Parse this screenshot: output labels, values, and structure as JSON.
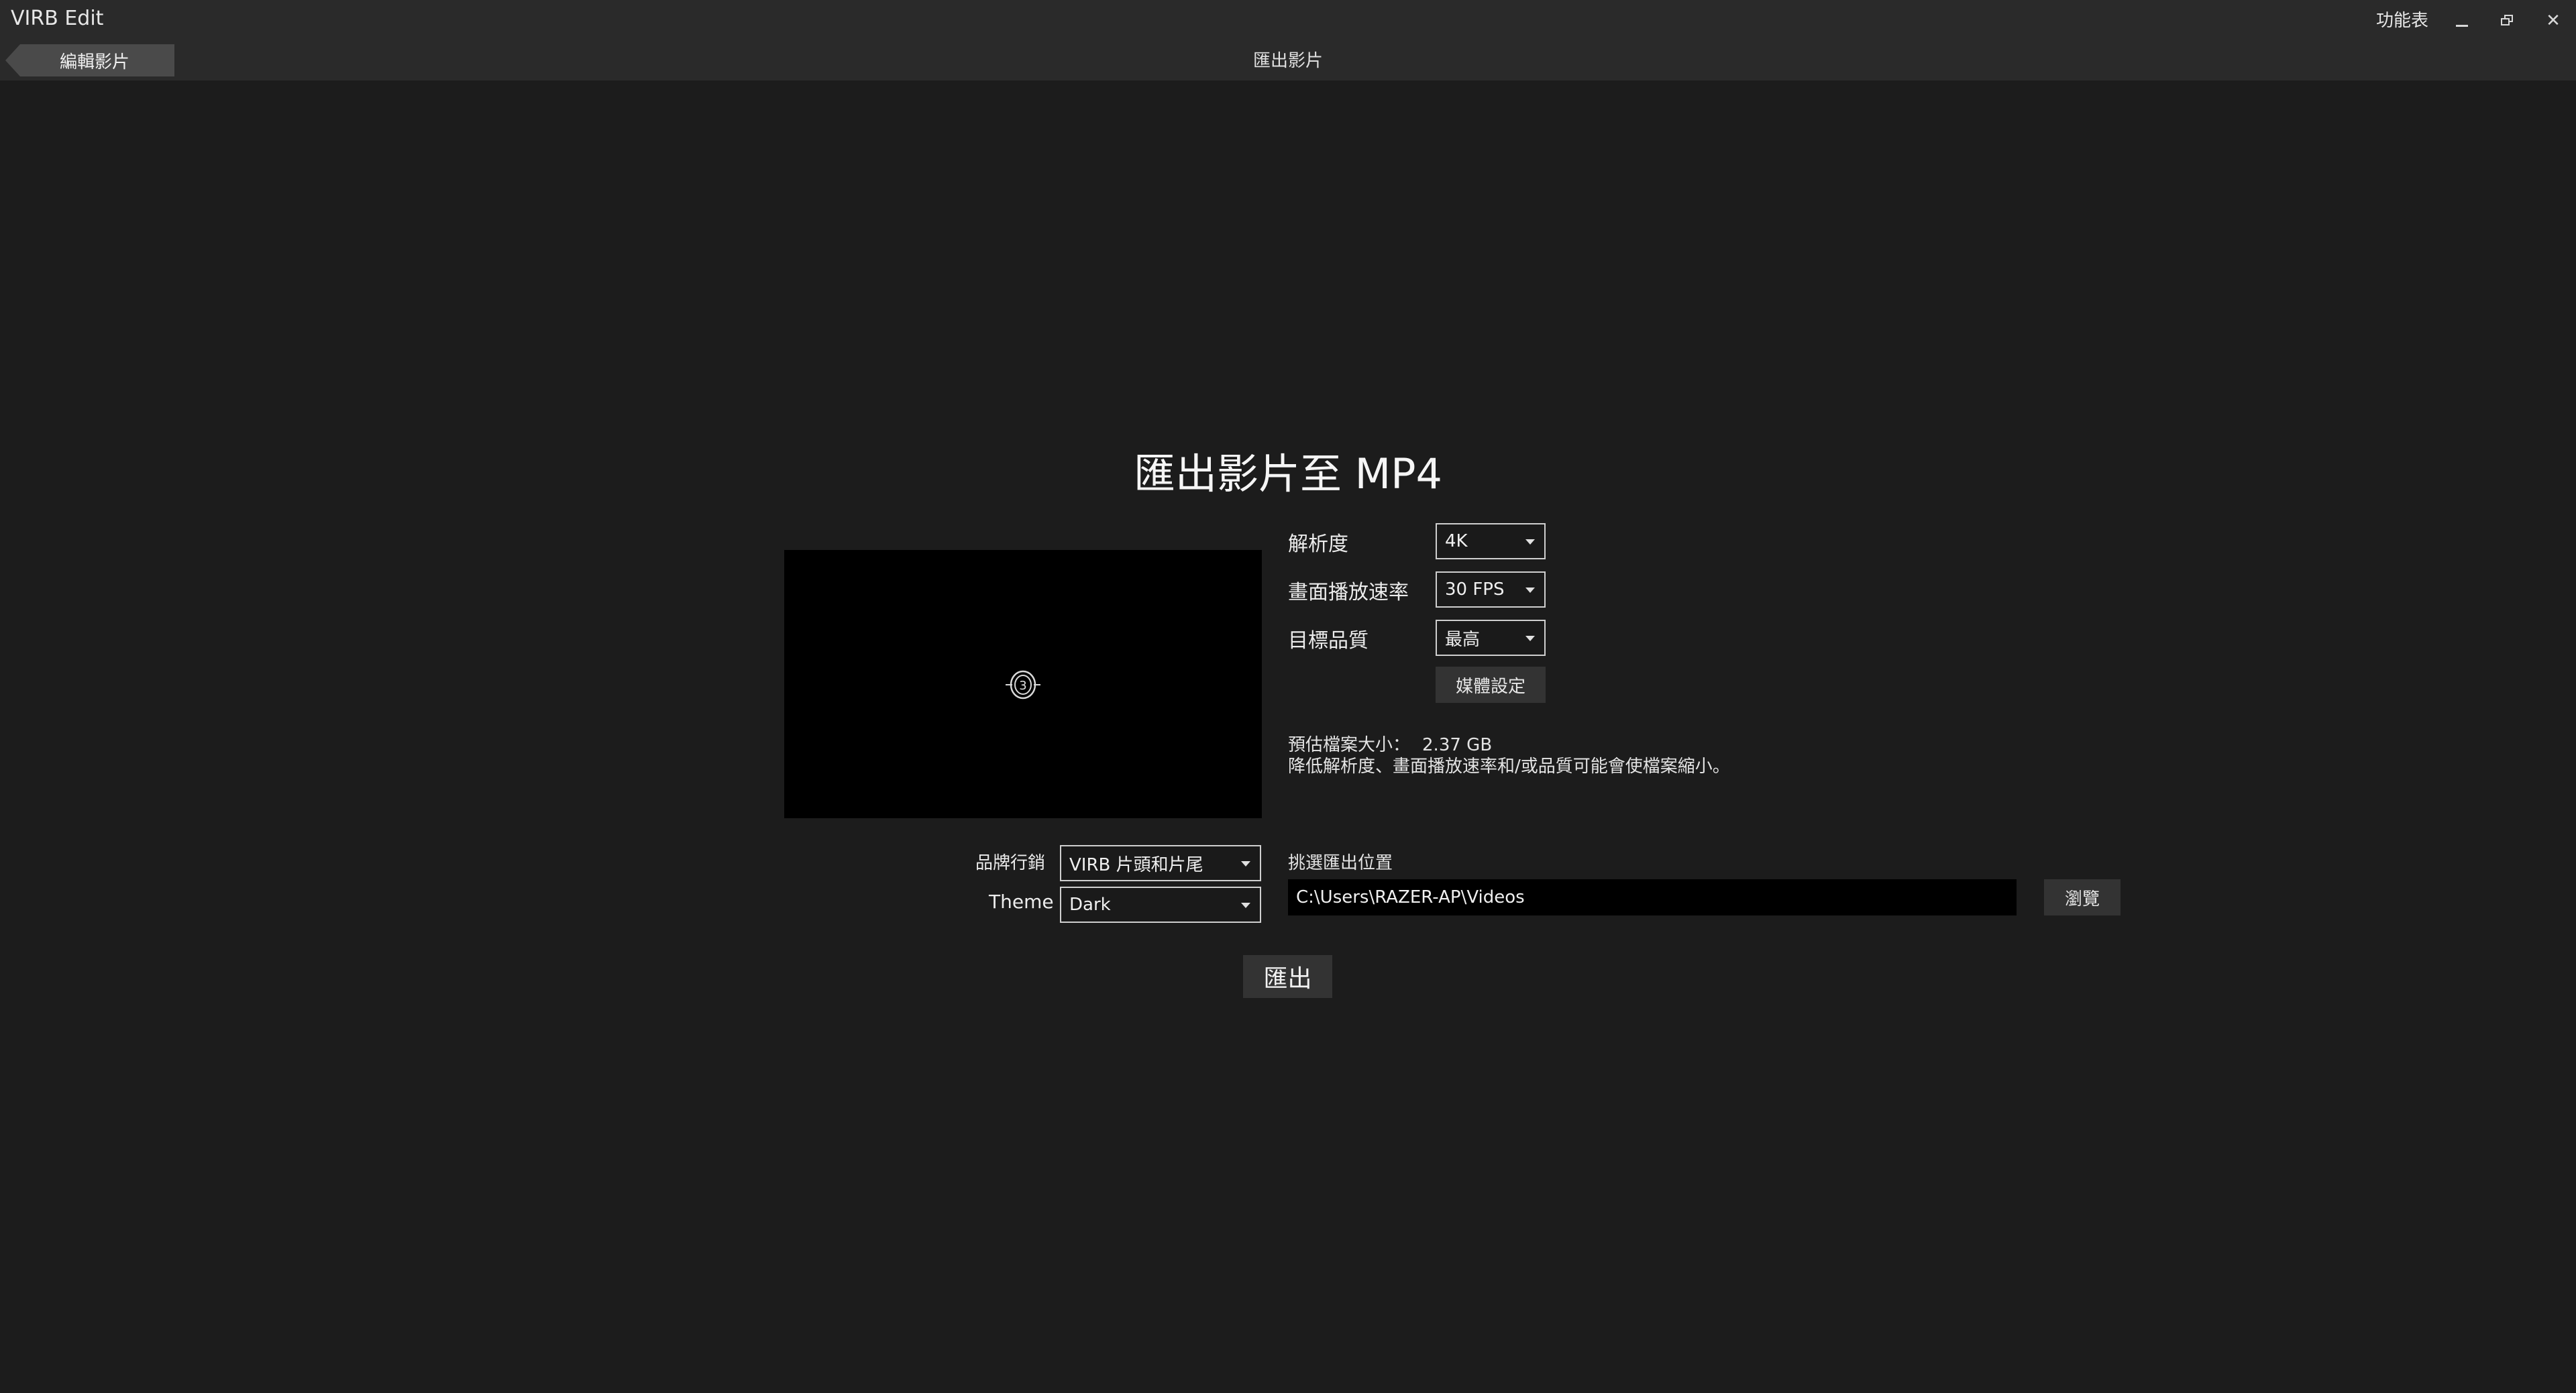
{
  "titlebar": {
    "app_title": "VIRB Edit",
    "menu_label": "功能表",
    "minimize_icon": "minimize-icon",
    "restore_icon": "restore-icon",
    "close_glyph": "✕"
  },
  "nav": {
    "back_label": "編輯影片",
    "page_heading": "匯出影片"
  },
  "main": {
    "title": "匯出影片至 MP4",
    "resolution": {
      "label": "解析度",
      "value": "4K"
    },
    "framerate": {
      "label": "畫面播放速率",
      "value": "30 FPS"
    },
    "quality": {
      "label": "目標品質",
      "value": "最高"
    },
    "media_settings_label": "媒體設定",
    "estimated_size_label": "預估檔案大小：",
    "estimated_size_value": "2.37 GB",
    "size_note": "降低解析度、畫面播放速率和/或品質可能會使檔案縮小。",
    "branding": {
      "label": "品牌行銷",
      "value": "VIRB 片頭和片尾"
    },
    "theme": {
      "label": "Theme",
      "value": "Dark"
    },
    "location_label": "挑選匯出位置",
    "export_path": "C:\\Users\\RAZER-AP\\Videos",
    "browse_label": "瀏覽",
    "export_label": "匯出"
  },
  "preview": {
    "spinner_digit": "3"
  },
  "colors": {
    "background": "#1c1c1c",
    "titlebar": "#2a2a2a",
    "button": "#333333",
    "preview": "#000000"
  }
}
